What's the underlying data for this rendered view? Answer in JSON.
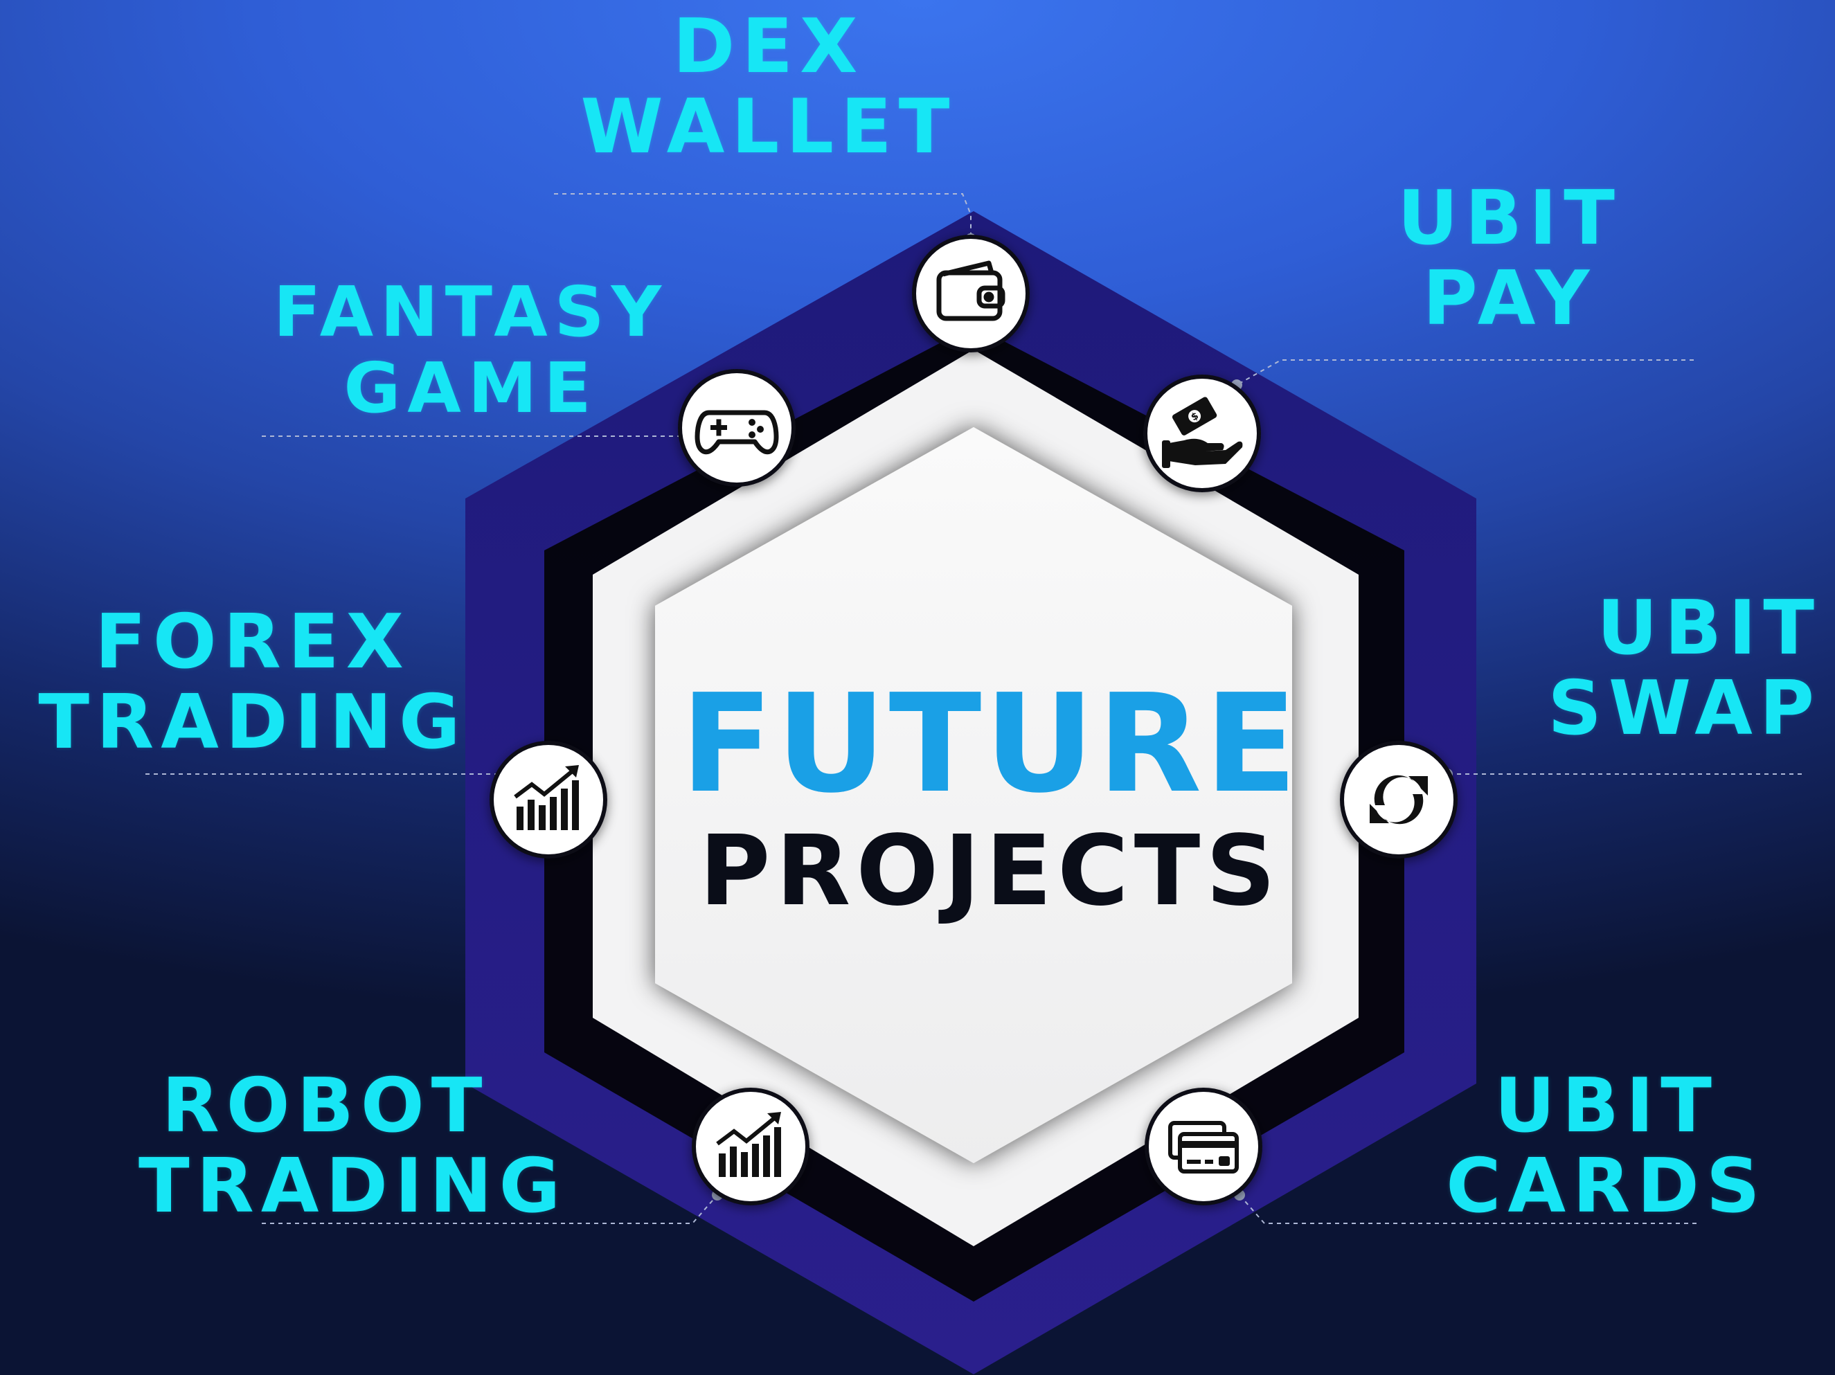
{
  "center": {
    "line1": "FUTURE",
    "line2": "PROJECTS"
  },
  "projects": {
    "dex_wallet": {
      "line1": "DEX",
      "line2": "WALLET",
      "icon": "wallet-icon"
    },
    "ubit_pay": {
      "line1": "UBIT",
      "line2": "PAY",
      "icon": "hand-money-icon"
    },
    "fantasy_game": {
      "line1": "FANTASY",
      "line2": "GAME",
      "icon": "gamepad-icon"
    },
    "forex_trading": {
      "line1": "FOREX",
      "line2": "TRADING",
      "icon": "trend-chart-icon"
    },
    "ubit_swap": {
      "line1": "UBIT",
      "line2": "SWAP",
      "icon": "swap-arrows-icon"
    },
    "robot_trading": {
      "line1": "ROBOT",
      "line2": "TRADING",
      "icon": "trend-chart-icon"
    },
    "ubit_cards": {
      "line1": "UBIT",
      "line2": "CARDS",
      "icon": "credit-cards-icon"
    }
  },
  "colors": {
    "label": "#17e6f5",
    "title_blue": "#1aa0e6",
    "title_dark": "#0a0d18",
    "hex_outer": "#1b1670",
    "hex_inner": "#f2f2f3",
    "background_top": "#3b74ee",
    "background_bottom": "#0b1434"
  }
}
